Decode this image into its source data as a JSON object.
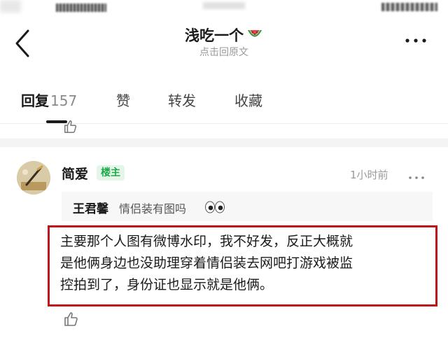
{
  "nav": {
    "title": "浅吃一个",
    "subtitle": "点击回原文"
  },
  "tabs": [
    {
      "label": "回复",
      "count": "157"
    },
    {
      "label": "赞"
    },
    {
      "label": "转发"
    },
    {
      "label": "收藏"
    }
  ],
  "comment": {
    "user_name": "简爱",
    "badge": "楼主",
    "time": "1小时前",
    "quote": {
      "author": "王君馨",
      "text": "情侣装有图吗"
    },
    "lines": [
      "主要那个人图有微博水印，我不好发，反正大概就",
      "是他俩身边也没助理穿着情侣装去网吧打游戏被监",
      "控拍到了，身份证也显示就是他俩。"
    ]
  },
  "icons": {
    "back": "chevron-left-icon",
    "title_emoji": "watermelon-icon",
    "more": "more-dots-icon",
    "quote_emoji": "eyes-icon",
    "like": "thumbs-up-icon"
  },
  "colors": {
    "badge_text": "#1fa84a",
    "badge_bg": "#e5f6e9",
    "highlight_border": "#c0141c",
    "muted_text": "#9a9a9a"
  }
}
